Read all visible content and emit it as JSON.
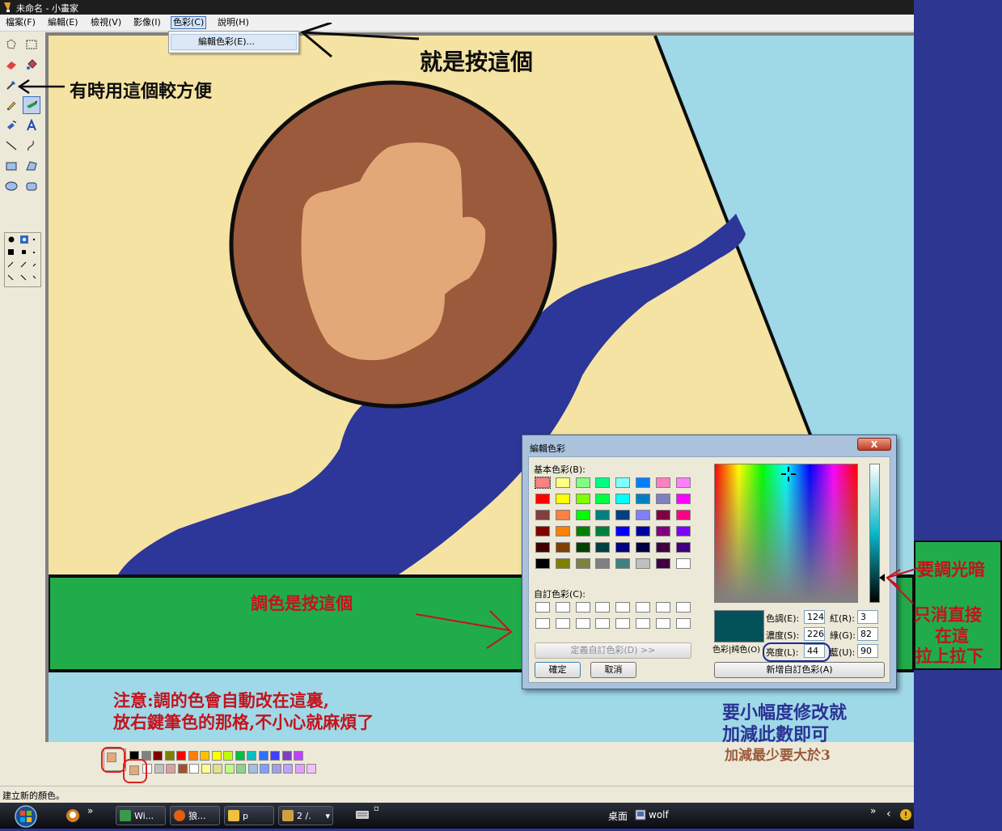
{
  "window": {
    "title": "未命名 - 小畫家",
    "menus": [
      "檔案(F)",
      "編輯(E)",
      "檢視(V)",
      "影像(I)",
      "色彩(C)",
      "說明(H)"
    ],
    "color_menu_item": "編輯色彩(E)..."
  },
  "statusbar": {
    "text": "建立新的顏色。"
  },
  "palette": {
    "foreground_color": "#e6a975",
    "background_color": "#e6a975",
    "top_row": [
      "#000000",
      "#808080",
      "#800000",
      "#808000",
      "#ff0000",
      "#ff8000",
      "#ffc000",
      "#ffff00",
      "#c0ff00",
      "#00c040",
      "#00c0c0",
      "#3070ff",
      "#4040ff",
      "#8040c0",
      "#c040ff"
    ],
    "bottom_row": [
      "#ffffff",
      "#c0c0c0",
      "#d8a0a0",
      "#a0522d",
      "#ffffff",
      "#ffff90",
      "#e0e090",
      "#c0ff80",
      "#90d090",
      "#a0c0e0",
      "#80a0ff",
      "#a0a0e0",
      "#c0a0ff",
      "#e0a0ff",
      "#f0c0ff"
    ]
  },
  "colors": {
    "sand": "#f5e3a3",
    "sky": "#9fd9e8",
    "river": "#2d3699",
    "grass": "#21ac4b",
    "circle_brown": "#9a5a3b",
    "face_tan": "#e3a878",
    "outline": "#0d0d0d",
    "ann_red": "#c2141c",
    "ann_blue": "#2a3393",
    "ann_brown": "#9b5a3b"
  },
  "dialog": {
    "title": "編輯色彩",
    "close_label": "X",
    "basic_colors_label": "基本色彩(B):",
    "basic_colors": [
      [
        "#ff8080",
        "#ffff80",
        "#80ff80",
        "#00ff80",
        "#80ffff",
        "#0080ff",
        "#ff80c0",
        "#ff80ff"
      ],
      [
        "#ff0000",
        "#ffff00",
        "#80ff00",
        "#00ff40",
        "#00ffff",
        "#0080c0",
        "#8080c0",
        "#ff00ff"
      ],
      [
        "#804040",
        "#ff8040",
        "#00ff00",
        "#008080",
        "#004080",
        "#8080ff",
        "#800040",
        "#ff0080"
      ],
      [
        "#800000",
        "#ff8000",
        "#008000",
        "#008040",
        "#0000ff",
        "#0000a0",
        "#800080",
        "#8000ff"
      ],
      [
        "#400000",
        "#804000",
        "#004000",
        "#004040",
        "#000080",
        "#000040",
        "#400040",
        "#400080"
      ],
      [
        "#000000",
        "#808000",
        "#808040",
        "#808080",
        "#408080",
        "#c0c0c0",
        "#400040",
        "#ffffff"
      ]
    ],
    "custom_colors_label": "自訂色彩(C):",
    "define_custom_button": "定義自訂色彩(D) >>",
    "ok_button": "確定",
    "cancel_button": "取消",
    "color_solid_label": "色彩|純色(O)",
    "hue_label": "色調(E):",
    "hue_value": "124",
    "sat_label": "濃度(S):",
    "sat_value": "226",
    "lum_label": "亮度(L):",
    "lum_value": "44",
    "red_label": "紅(R):",
    "red_value": "3",
    "green_label": "綠(G):",
    "green_value": "82",
    "blue_label": "藍(U):",
    "blue_value": "90",
    "add_custom_button": "新增自訂色彩(A)",
    "current_color": "#03525a"
  },
  "taskbar": {
    "buttons": [
      "Wi...",
      "狼...",
      "p",
      "2 /."
    ],
    "desktop_label": "桌面",
    "wolf_label": "wolf",
    "chevron": "»"
  },
  "annotations": {
    "menu_hint": "就是按這個",
    "eyedropper_hint": "有時用這個較方便",
    "palette_hint": "調色是按這個",
    "warning_line1": "注意:調的色會自動改在這裏,",
    "warning_line2": "放右鍵筆色的那格,不小心就麻煩了",
    "fine_tune_line1": "要小幅度修改就",
    "fine_tune_line2": "加減此數即可",
    "fine_tune_line3": "加減最少要大於3",
    "brightness_title": "要調光暗",
    "brightness_line1": "只消直接",
    "brightness_line2": "在這",
    "brightness_line3": "拉上拉下"
  }
}
